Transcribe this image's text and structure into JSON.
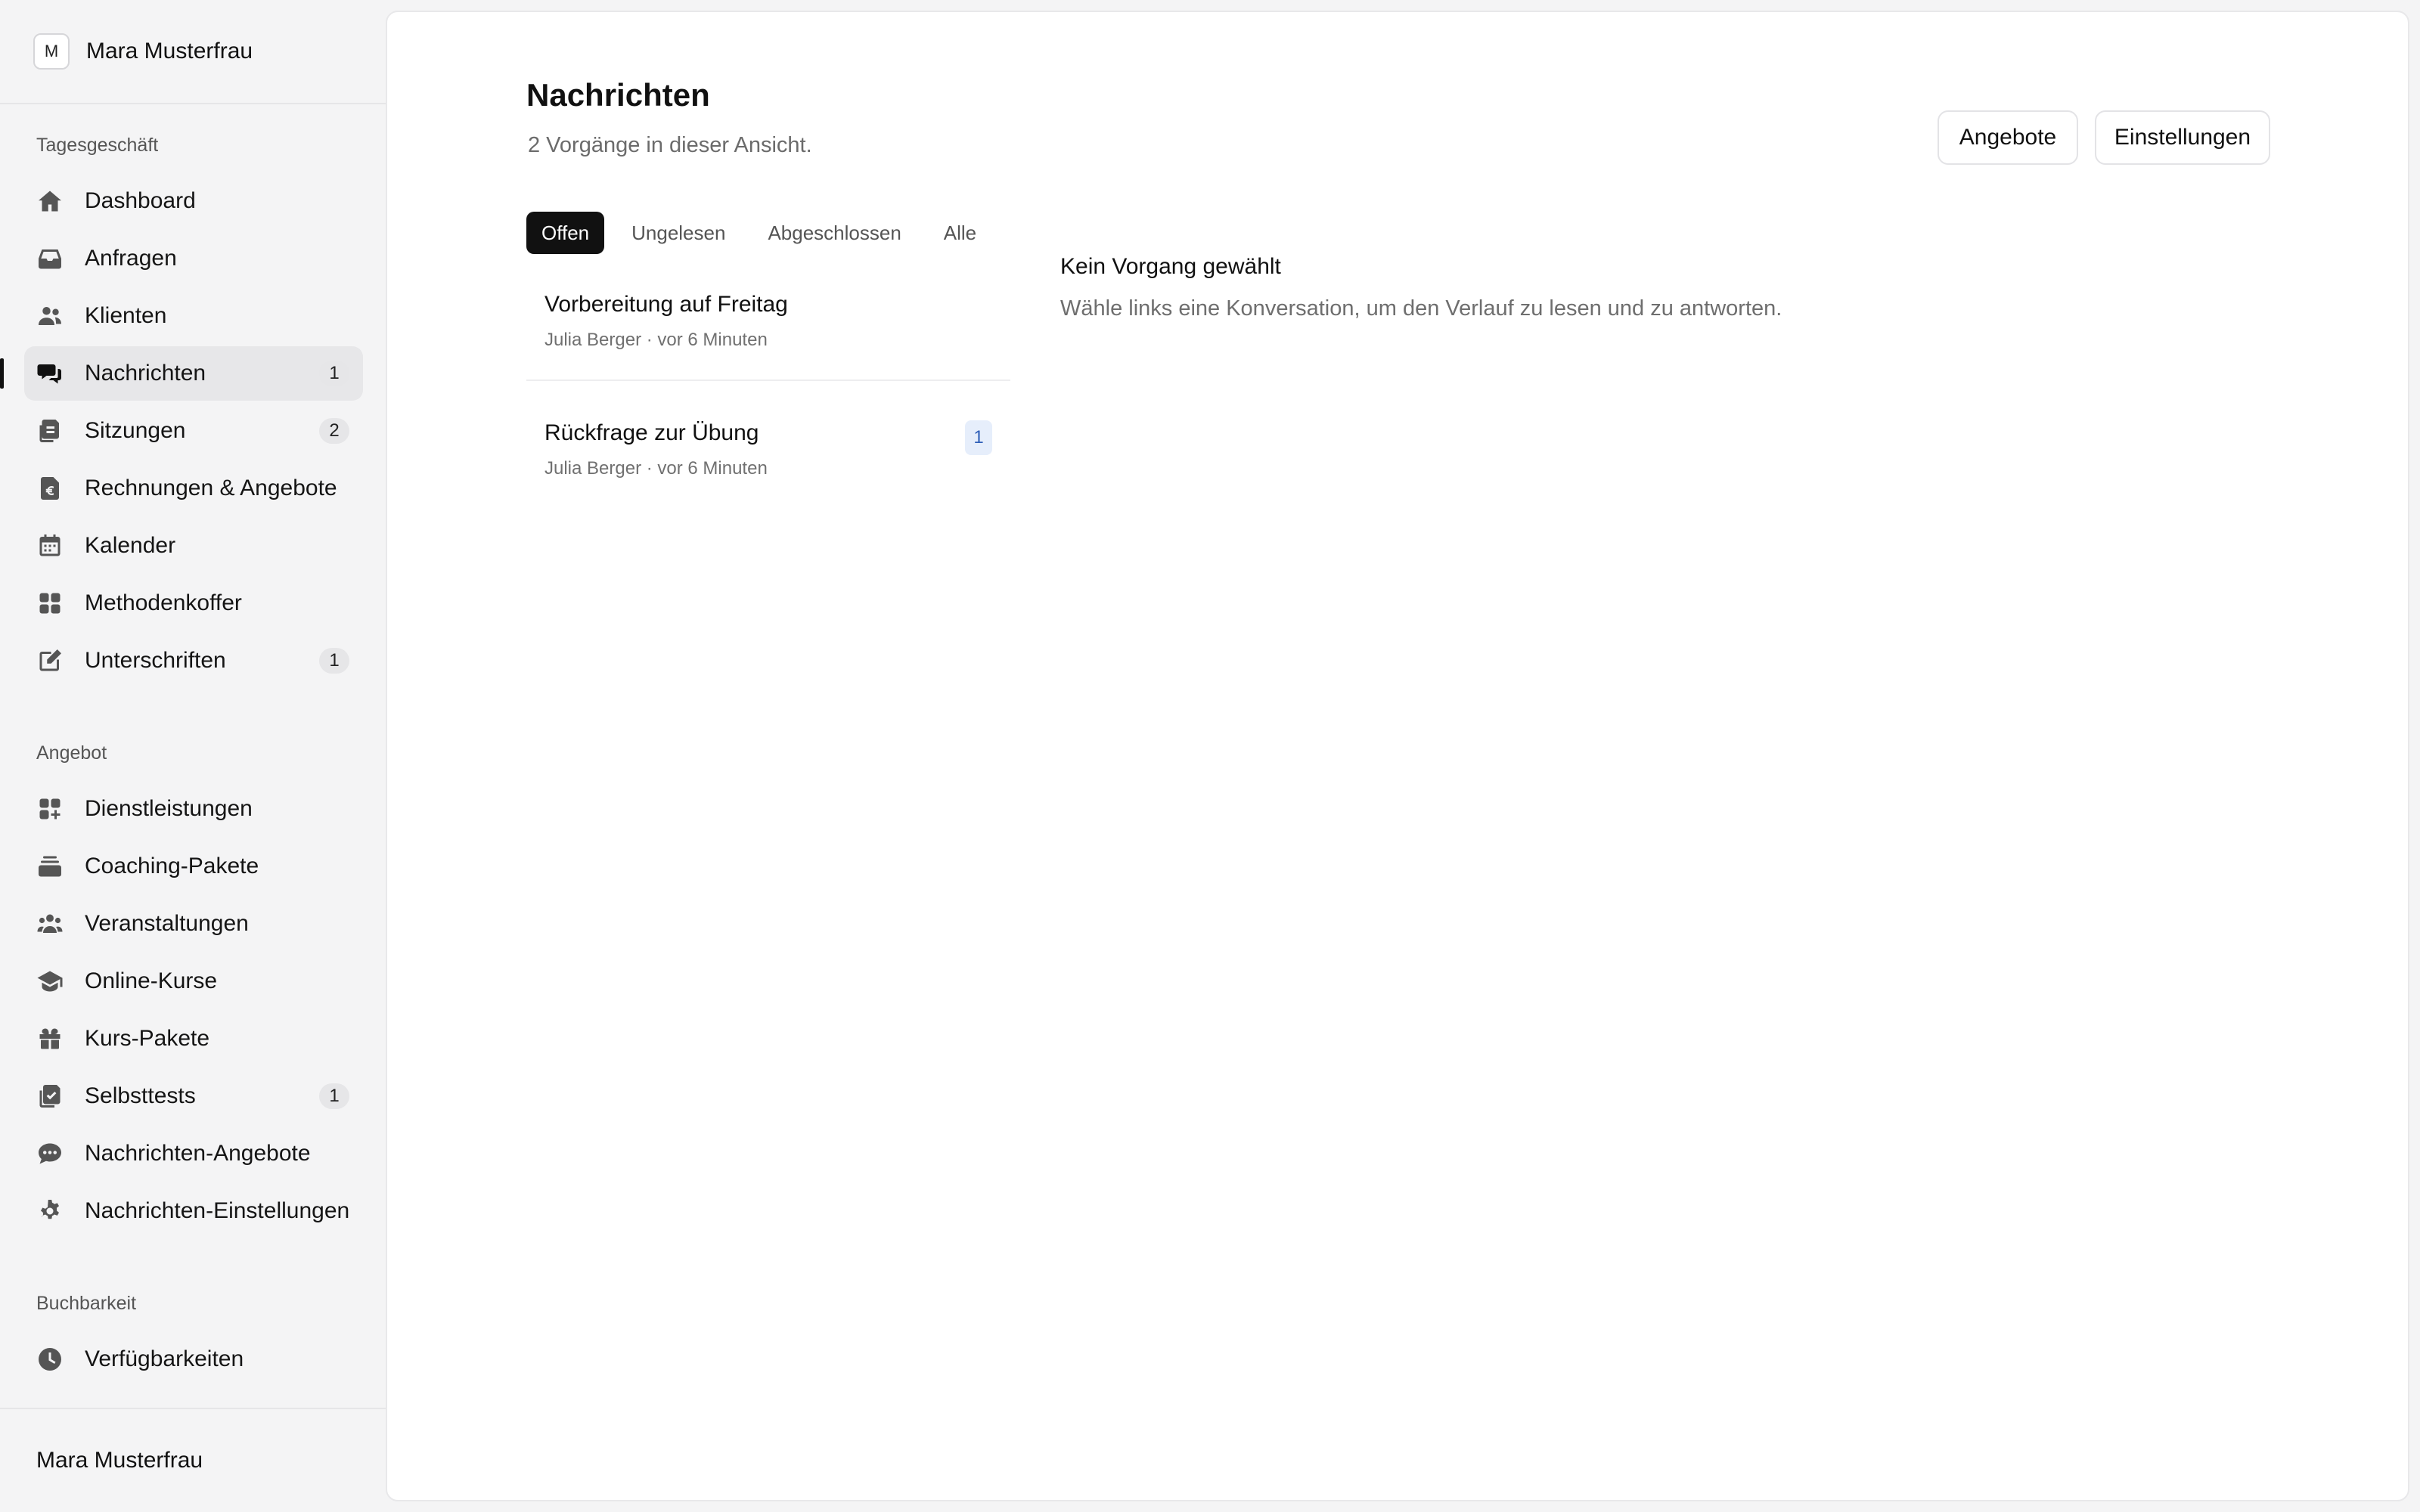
{
  "workspace": {
    "avatar_letter": "M",
    "name": "Mara Musterfrau"
  },
  "sidebar": {
    "sections": [
      {
        "label": "Tagesgeschäft"
      },
      {
        "label": "Angebot"
      },
      {
        "label": "Buchbarkeit"
      }
    ],
    "items": [
      {
        "label": "Dashboard",
        "icon": "home-icon"
      },
      {
        "label": "Anfragen",
        "icon": "inbox-icon"
      },
      {
        "label": "Klienten",
        "icon": "users-icon"
      },
      {
        "label": "Nachrichten",
        "icon": "chat-icon",
        "count": "1",
        "active": true
      },
      {
        "label": "Sitzungen",
        "icon": "documents-icon",
        "count": "2"
      },
      {
        "label": "Rechnungen & Angebote",
        "icon": "invoice-euro-icon"
      },
      {
        "label": "Kalender",
        "icon": "calendar-icon"
      },
      {
        "label": "Methodenkoffer",
        "icon": "grid-icon"
      },
      {
        "label": "Unterschriften",
        "icon": "pen-square-icon",
        "count": "1"
      },
      {
        "label": "Dienstleistungen",
        "icon": "grid-plus-icon"
      },
      {
        "label": "Coaching-Pakete",
        "icon": "stack-icon"
      },
      {
        "label": "Veranstaltungen",
        "icon": "group-icon"
      },
      {
        "label": "Online-Kurse",
        "icon": "graduation-cap-icon"
      },
      {
        "label": "Kurs-Pakete",
        "icon": "gift-icon"
      },
      {
        "label": "Selbsttests",
        "icon": "checklist-icon",
        "count": "1"
      },
      {
        "label": "Nachrichten-Angebote",
        "icon": "speech-bubble-icon"
      },
      {
        "label": "Nachrichten-Einstellungen",
        "icon": "gear-icon"
      },
      {
        "label": "Verfügbarkeiten",
        "icon": "clock-icon"
      }
    ],
    "footer_user": "Mara Musterfrau"
  },
  "main": {
    "title": "Nachrichten",
    "subtitle": "2 Vorgänge in dieser Ansicht.",
    "buttons": {
      "offers": "Angebote",
      "settings": "Einstellungen"
    },
    "tabs": [
      {
        "label": "Offen",
        "active": true
      },
      {
        "label": "Ungelesen"
      },
      {
        "label": "Abgeschlossen"
      },
      {
        "label": "Alle"
      }
    ],
    "conversations": [
      {
        "title": "Vorbereitung auf Freitag",
        "meta": "Julia Berger · vor 6 Minuten"
      },
      {
        "title": "Rückfrage zur Übung",
        "meta": "Julia Berger · vor 6 Minuten",
        "unread": "1"
      }
    ],
    "detail": {
      "title": "Kein Vorgang gewählt",
      "text": "Wähle links eine Konversation, um den Verlauf zu lesen und zu antworten."
    }
  },
  "colors": {
    "sidebar_bg": "#f4f4f5",
    "active_tab_bg": "#111111",
    "unread_badge_bg": "#e6eefb",
    "unread_badge_text": "#2f5fb8"
  }
}
